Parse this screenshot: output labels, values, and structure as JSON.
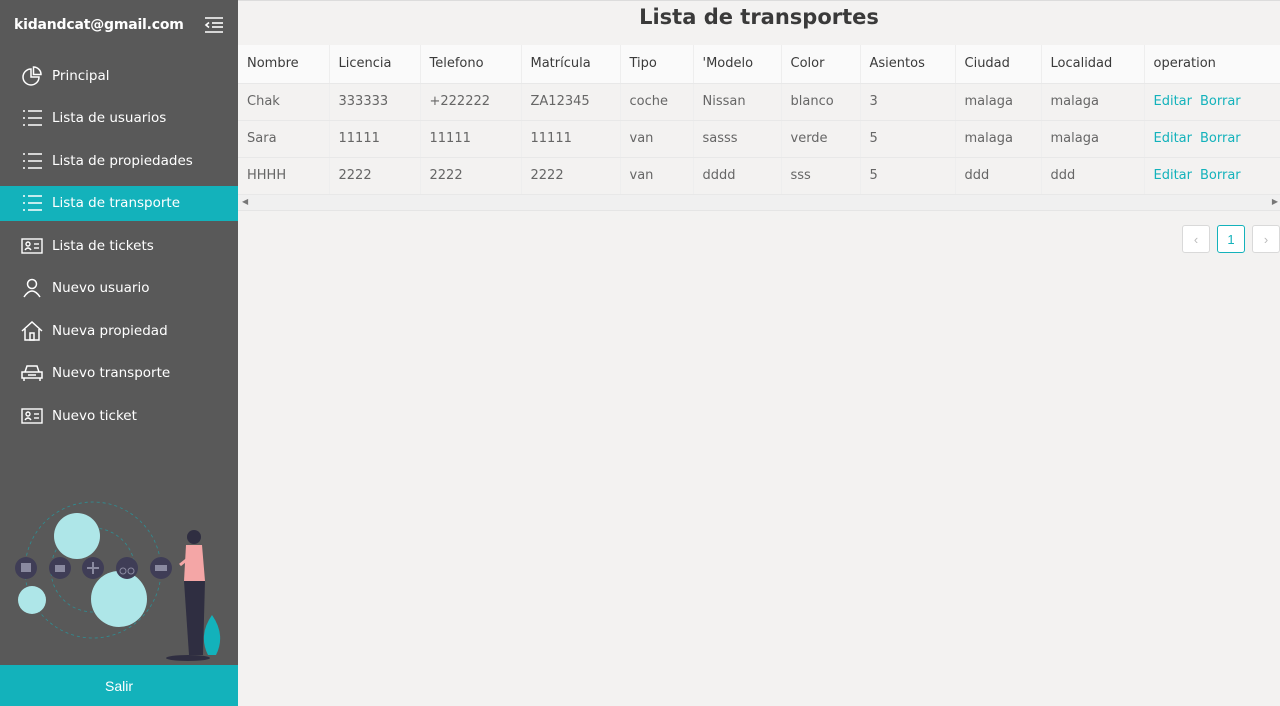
{
  "sidebar": {
    "email": "kidandcat@gmail.com",
    "items": [
      {
        "label": "Principal",
        "icon": "pie-chart-icon"
      },
      {
        "label": "Lista de usuarios",
        "icon": "list-icon"
      },
      {
        "label": "Lista de propiedades",
        "icon": "list-icon"
      },
      {
        "label": "Lista de transporte",
        "icon": "list-icon",
        "active": true
      },
      {
        "label": "Lista de tickets",
        "icon": "id-card-icon"
      },
      {
        "label": "Nuevo usuario",
        "icon": "user-icon"
      },
      {
        "label": "Nueva propiedad",
        "icon": "home-icon"
      },
      {
        "label": "Nuevo transporte",
        "icon": "car-icon"
      },
      {
        "label": "Nuevo ticket",
        "icon": "id-card-icon"
      }
    ],
    "logout_label": "Salir"
  },
  "main": {
    "title": "Lista de transportes",
    "columns": [
      "Nombre",
      "Licencia",
      "Telefono",
      "Matrícula",
      "Tipo",
      "'Modelo",
      "Color",
      "Asientos",
      "Ciudad",
      "Localidad",
      "operation"
    ],
    "rows": [
      [
        "Chak",
        "333333",
        "+222222",
        "ZA12345",
        "coche",
        "Nissan",
        "blanco",
        "3",
        "malaga",
        "malaga"
      ],
      [
        "Sara",
        "11111",
        "11111",
        "11111",
        "van",
        "sasss",
        "verde",
        "5",
        "malaga",
        "malaga"
      ],
      [
        "HHHH",
        "2222",
        "2222",
        "2222",
        "van",
        "dddd",
        "sss",
        "5",
        "ddd",
        "ddd"
      ]
    ],
    "actions": {
      "edit": "Editar",
      "delete": "Borrar"
    },
    "pagination": {
      "prev": "‹",
      "current": "1",
      "next": "›"
    }
  },
  "colors": {
    "accent": "#13b2bb",
    "sidebar": "#595959",
    "background": "#f3f2f1"
  }
}
